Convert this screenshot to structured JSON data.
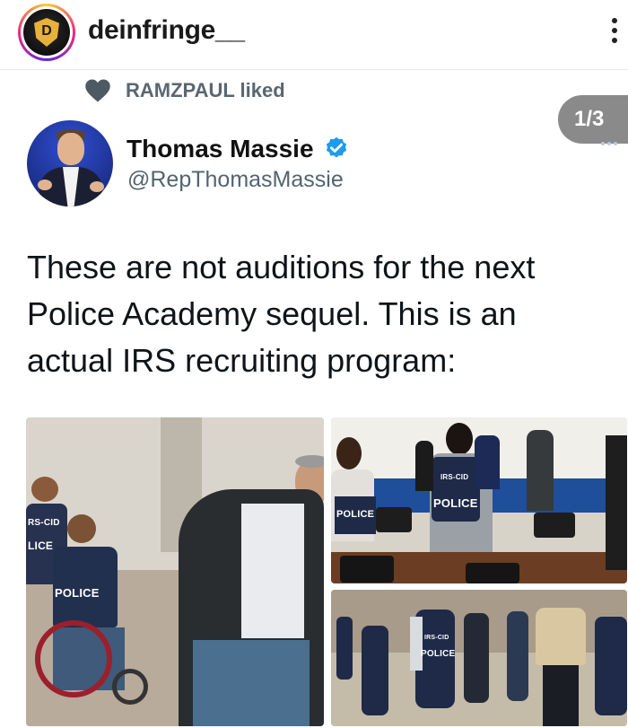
{
  "header": {
    "username": "deinfringe__",
    "avatar_icon": "shield-logo-icon",
    "more_icon": "more-vertical-icon"
  },
  "liked": {
    "icon": "heart-icon",
    "text": "RAMZPAUL liked"
  },
  "carousel": {
    "counter": "1/3"
  },
  "tweet": {
    "author_name": "Thomas Massie",
    "handle": "@RepThomasMassie",
    "verified": true,
    "text_lines": [
      "These are not auditions for the next",
      "Police Academy sequel. This is an",
      "actual IRS recruiting program:"
    ]
  },
  "photos": {
    "left_vest_label": "POLICE",
    "left_vest_label_partial": "LICE",
    "left_vest_label_partial_top": "RS-CID",
    "top_right_vest_label": "POLICE",
    "top_right_vest_label_top": "IRS-CID",
    "top_right_vest_label_left": "POLICE",
    "bottom_right_vest_label": "POLICE",
    "bottom_right_vest_label_top": "IRS-CID"
  },
  "colors": {
    "verified_blue": "#1d9bf0",
    "badge_gray": "#8a8a8a",
    "vest_navy": "#1e2a47"
  }
}
